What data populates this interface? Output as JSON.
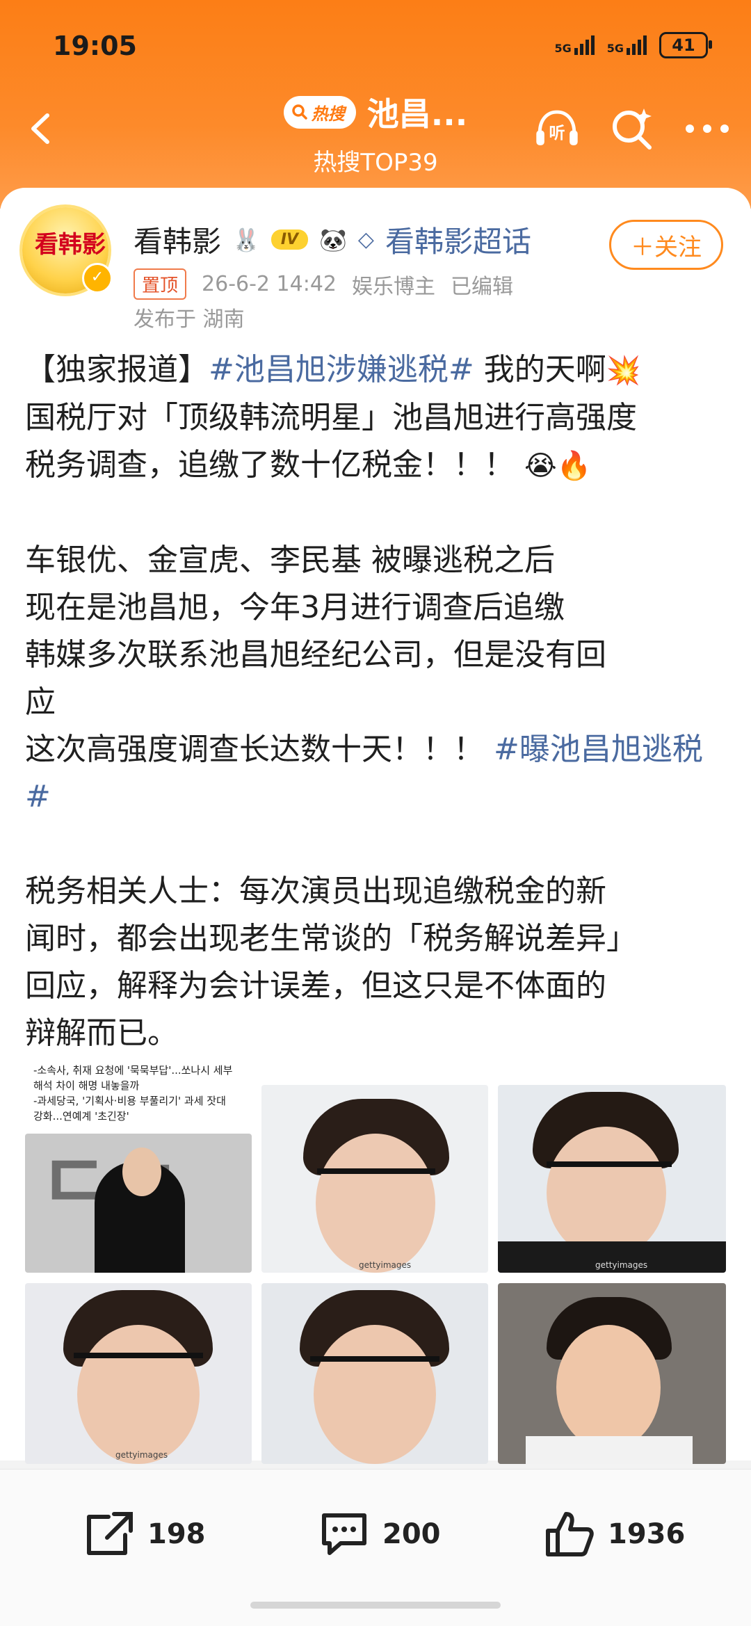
{
  "status": {
    "time": "19:05",
    "signal1": "5G",
    "signal2": "5G",
    "battery": "41"
  },
  "header": {
    "hot_badge": "热搜",
    "title": "池昌...",
    "subtitle": "热搜TOP39",
    "listen_label": "听"
  },
  "post": {
    "avatar_text": "看韩影",
    "username": "看韩影",
    "level": "IV",
    "topic_link": "看韩影超话",
    "follow_label": "＋关注",
    "pin_label": "置顶",
    "date": "26-6-2 14:42",
    "author_type": "娱乐博主",
    "edited": "已编辑",
    "location": "发布于 湖南",
    "p1_prefix": "【独家报道】",
    "p1_tag": "#池昌旭涉嫌逃税#",
    "p1_text": " 我的天啊",
    "p1_line2": "国税厅对「顶级韩流明星」池昌旭进行高强度",
    "p1_line3": "税务调查，追缴了数十亿税金！！！",
    "p2_line1": "车银优、金宣虎、李民基 被曝逃税之后",
    "p2_line2": "现在是池昌旭，今年3月进行调查后追缴",
    "p2_line3": "韩媒多次联系池昌旭经纪公司，但是没有回",
    "p2_line4": "应",
    "p2_line5": "这次高强度调查长达数十天！！！ ",
    "p2_tag": "#曝池昌旭逃税#",
    "p3_line1": "税务相关人士：每次演员出现追缴税金的新",
    "p3_line2": "闻时，都会出现老生常谈的「税务解说差异」",
    "p3_line3": "回应，解释为会计误差，但这只是不体面的",
    "p3_line4": "辩解而已。",
    "news_caption": "-소속사, 취재 요청에 '묵묵부답'...쏘나시 세부\n해석 차이 해명 내놓을까\n-과세당국, '기획사·비용 부풀리기' 과세 잣대\n강화...연예계 '초긴장'",
    "watermark": "gettyimages"
  },
  "actions": {
    "share_count": "198",
    "comment_count": "200",
    "like_count": "1936"
  },
  "colors": {
    "accent": "#ff8a1e",
    "link": "#4a6aa0"
  }
}
